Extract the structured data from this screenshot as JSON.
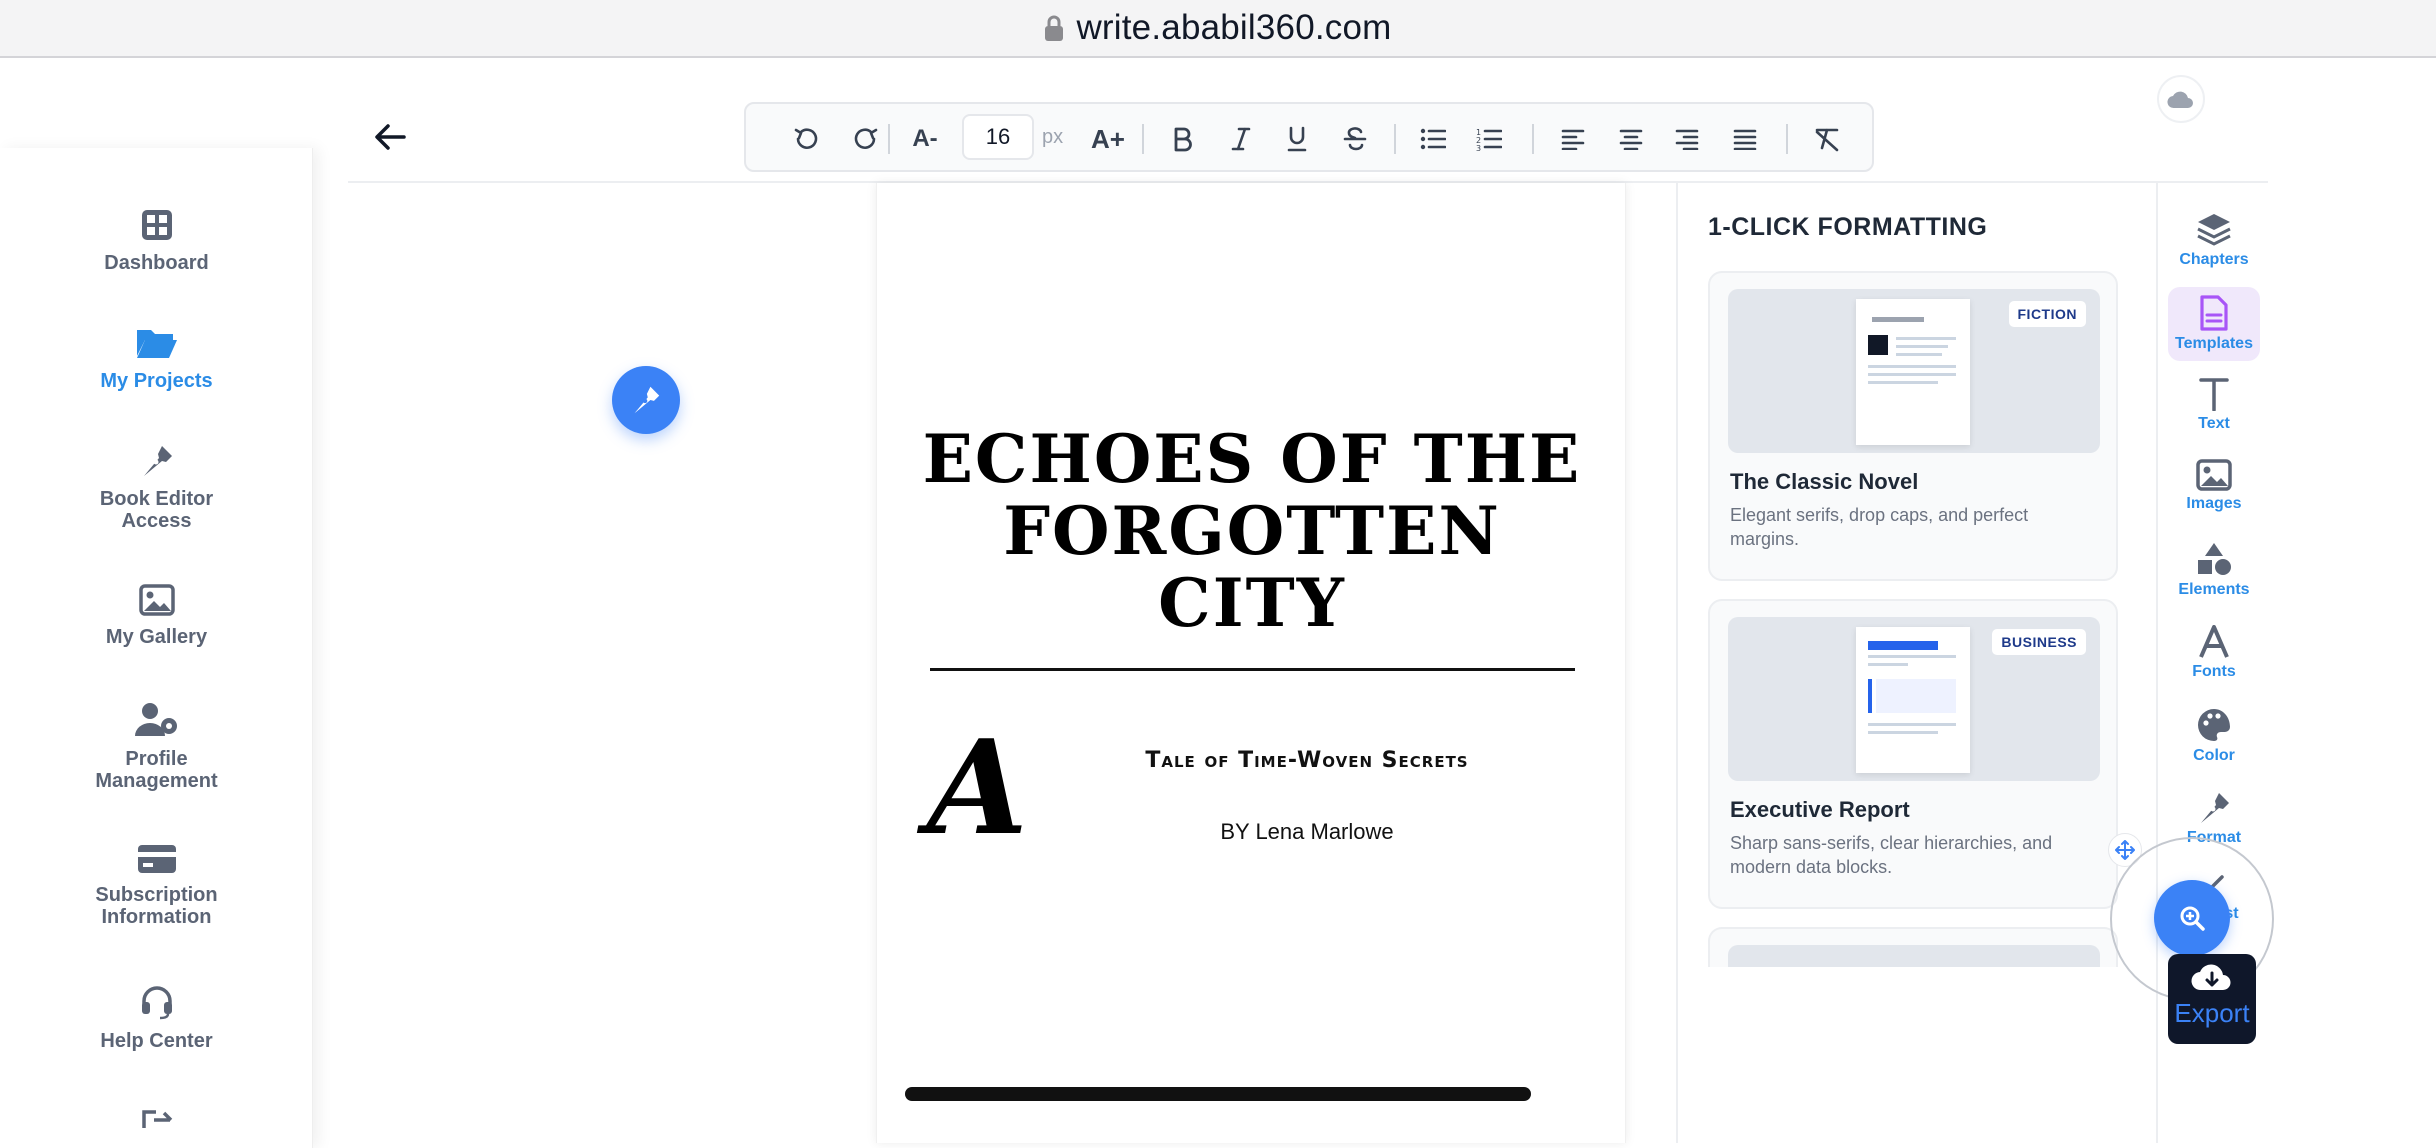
{
  "browser": {
    "url": "write.ababil360.com"
  },
  "sidebar": {
    "items": [
      {
        "label": "Dashboard",
        "icon": "grid-icon",
        "active": false
      },
      {
        "label": "My Projects",
        "icon": "folder-open-icon",
        "active": true
      },
      {
        "label": "Book Editor\nAccess",
        "icon": "pen-nib-icon",
        "active": false
      },
      {
        "label": "My Gallery",
        "icon": "image-icon",
        "active": false
      },
      {
        "label": "Profile\nManagement",
        "icon": "user-gear-icon",
        "active": false
      },
      {
        "label": "Subscription\nInformation",
        "icon": "credit-card-icon",
        "active": false
      },
      {
        "label": "Help Center",
        "icon": "headset-icon",
        "active": false
      }
    ]
  },
  "toolbar": {
    "font_decrease": "A-",
    "font_size": "16",
    "font_unit": "px",
    "font_increase": "A+",
    "buttons": [
      "undo-icon",
      "redo-icon",
      "bold-icon",
      "italic-icon",
      "underline-icon",
      "strikethrough-icon",
      "bullet-list-icon",
      "numbered-list-icon",
      "align-left-icon",
      "align-center-icon",
      "align-right-icon",
      "align-justify-icon",
      "clear-format-icon"
    ]
  },
  "document": {
    "title": "ECHOES OF THE FORGOTTEN CITY",
    "drop_cap": "A",
    "subtitle": "Tale of Time-Woven Secrets",
    "author": "BY Lena Marlowe"
  },
  "panel": {
    "title": "1-CLICK FORMATTING",
    "templates": [
      {
        "name": "The Classic Novel",
        "tag": "FICTION",
        "description": "Elegant serifs, drop caps, and perfect margins."
      },
      {
        "name": "Executive Report",
        "tag": "BUSINESS",
        "description": "Sharp sans-serifs, clear hierarchies, and modern data blocks."
      }
    ]
  },
  "rail": {
    "items": [
      {
        "label": "Chapters",
        "icon": "layers-icon",
        "active": false
      },
      {
        "label": "Templates",
        "icon": "template-doc-icon",
        "active": true
      },
      {
        "label": "Text",
        "icon": "text-t-icon",
        "active": false
      },
      {
        "label": "Images",
        "icon": "image-icon",
        "active": false
      },
      {
        "label": "Elements",
        "icon": "shapes-icon",
        "active": false
      },
      {
        "label": "Fonts",
        "icon": "font-a-icon",
        "active": false
      },
      {
        "label": "Color",
        "icon": "palette-icon",
        "active": false
      },
      {
        "label": "Format",
        "icon": "pen-nib-icon",
        "active": false
      },
      {
        "label": "list",
        "icon": "list-icon",
        "active": false
      }
    ],
    "export_label": "Export"
  },
  "colors": {
    "accent": "#2b8ce6",
    "fab_blue": "#3b82f6",
    "export_bg": "#0f172a",
    "active_rail_bg": "#f0e8fb"
  }
}
